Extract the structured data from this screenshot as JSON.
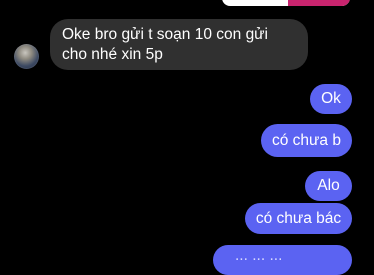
{
  "conversation": {
    "messages": [
      {
        "direction": "received",
        "text": "Oke bro gửi t soạn 10 con gửi cho nhé xin 5p"
      },
      {
        "direction": "sent",
        "text": "Ok"
      },
      {
        "direction": "sent",
        "text": "có chưa b"
      },
      {
        "direction": "sent",
        "text": "Alo"
      },
      {
        "direction": "sent",
        "text": "có chưa bác"
      },
      {
        "direction": "sent",
        "text": "...  ...  ..."
      }
    ]
  },
  "colors": {
    "background": "#000000",
    "sent_bubble": "#5b63f2",
    "received_bubble": "#303030",
    "text": "#ffffff"
  }
}
